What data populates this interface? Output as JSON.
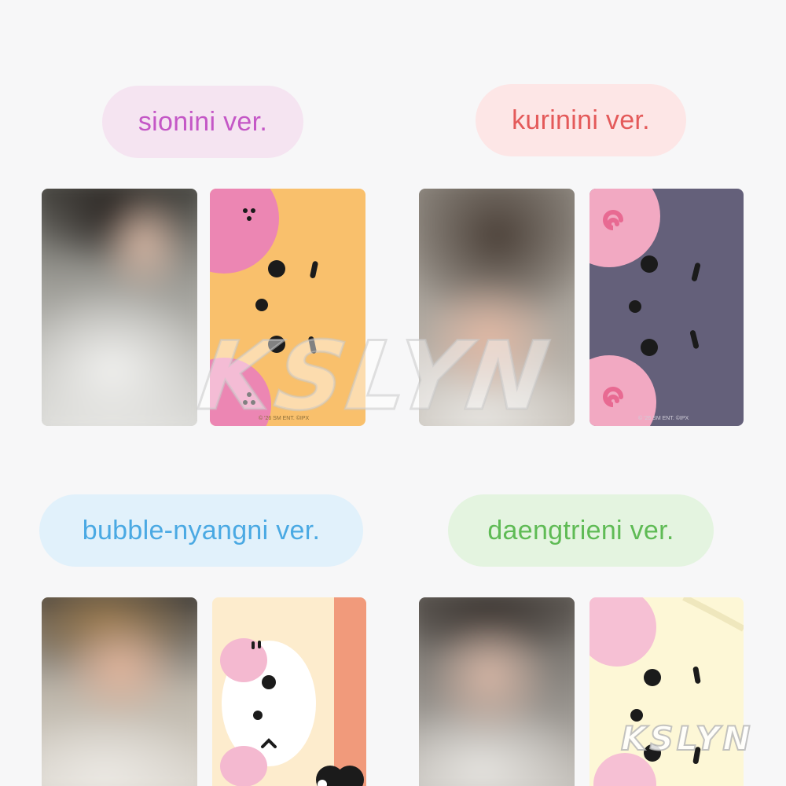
{
  "versions": [
    {
      "label": "sionini ver.",
      "text_color": "#c457c6",
      "pill_color": "#f5e4f1"
    },
    {
      "label": "kurinini ver.",
      "text_color": "#e45a5a",
      "pill_color": "#fde6e6"
    },
    {
      "label": "bubble-nyangni ver.",
      "text_color": "#4aa9e3",
      "pill_color": "#e1f1fb"
    },
    {
      "label": "daengtrieni ver.",
      "text_color": "#5fbb55",
      "pill_color": "#e4f4e0"
    }
  ],
  "card_back_copyright": "© '26 SM ENT.  ©IPX",
  "watermark": "KSLYN",
  "icons": [
    "bear-face-icon",
    "swirl-icon",
    "dots-icon"
  ],
  "colors": {
    "sionini_card": "#f9c06c",
    "sionini_ears": "#ec86b3",
    "kurinini_card": "#64607a",
    "kurinini_ears": "#f2a9c2",
    "bubble_card": "#fdeccd",
    "bubble_stripe": "#f19a7b",
    "daeng_card": "#fdf7d6",
    "daeng_ears": "#f6c0d4"
  }
}
